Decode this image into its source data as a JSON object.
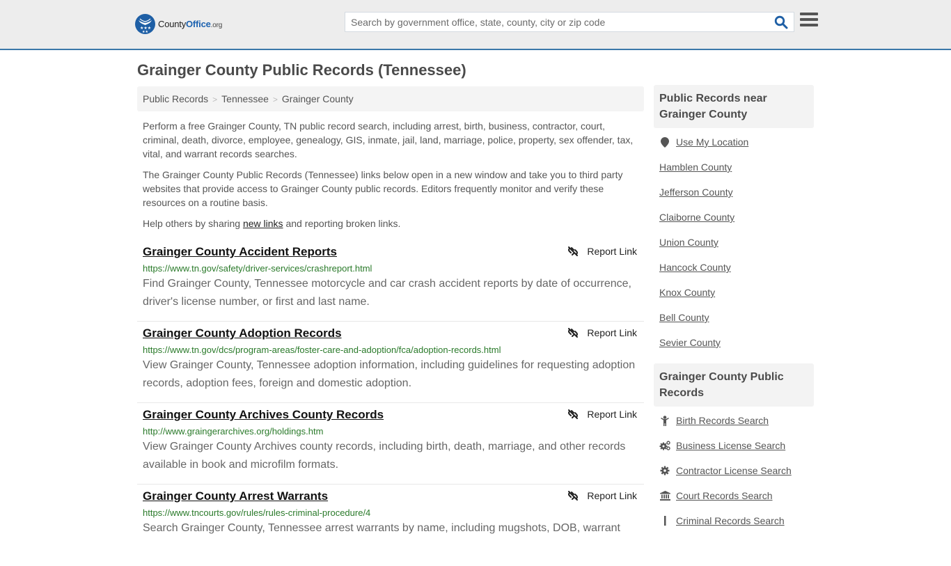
{
  "header": {
    "logo": {
      "county": "County",
      "office": "Office",
      "org": ".org"
    },
    "search_placeholder": "Search by government office, state, county, city or zip code",
    "search_value": ""
  },
  "page": {
    "title": "Grainger County Public Records (Tennessee)",
    "breadcrumb": [
      "Public Records",
      "Tennessee",
      "Grainger County"
    ],
    "intro": {
      "p1": "Perform a free Grainger County, TN public record search, including arrest, birth, business, contractor, court, criminal, death, divorce, employee, genealogy, GIS, inmate, jail, land, marriage, police, property, sex offender, tax, vital, and warrant records searches.",
      "p2": "The Grainger County Public Records (Tennessee) links below open in a new window and take you to third party websites that provide access to Grainger County public records. Editors frequently monitor and verify these resources on a routine basis.",
      "p3_before": "Help others by sharing ",
      "p3_link": "new links",
      "p3_after": " and reporting broken links."
    },
    "report_label": "Report Link",
    "results": [
      {
        "title": "Grainger County Accident Reports",
        "url": "https://www.tn.gov/safety/driver-services/crashreport.html",
        "desc": "Find Grainger County, Tennessee motorcycle and car crash accident reports by date of occurrence, driver's license number, or first and last name."
      },
      {
        "title": "Grainger County Adoption Records",
        "url": "https://www.tn.gov/dcs/program-areas/foster-care-and-adoption/fca/adoption-records.html",
        "desc": "View Grainger County, Tennessee adoption information, including guidelines for requesting adoption records, adoption fees, foreign and domestic adoption."
      },
      {
        "title": "Grainger County Archives County Records",
        "url": "http://www.graingerarchives.org/holdings.htm",
        "desc": "View Grainger County Archives county records, including birth, death, marriage, and other records available in book and microfilm formats."
      },
      {
        "title": "Grainger County Arrest Warrants",
        "url": "https://www.tncourts.gov/rules/rules-criminal-procedure/4",
        "desc": "Search Grainger County, Tennessee arrest warrants by name, including mugshots, DOB, warrant"
      }
    ]
  },
  "sidebar": {
    "near_heading": "Public Records near Grainger County",
    "use_location": "Use My Location",
    "near_counties": [
      "Hamblen County",
      "Jefferson County",
      "Claiborne County",
      "Union County",
      "Hancock County",
      "Knox County",
      "Bell County",
      "Sevier County"
    ],
    "records_heading": "Grainger County Public Records",
    "records_links": [
      {
        "label": "Birth Records Search",
        "icon": "child-icon"
      },
      {
        "label": "Business License Search",
        "icon": "cogs-icon"
      },
      {
        "label": "Contractor License Search",
        "icon": "gear-icon"
      },
      {
        "label": "Court Records Search",
        "icon": "courthouse-icon"
      },
      {
        "label": "Criminal Records Search",
        "icon": "person-icon"
      }
    ]
  },
  "colors": {
    "header_bg": "#ededed",
    "header_border": "#3b78a9",
    "brand_blue": "#1e5fa5",
    "url_green": "#2a7a2a"
  }
}
